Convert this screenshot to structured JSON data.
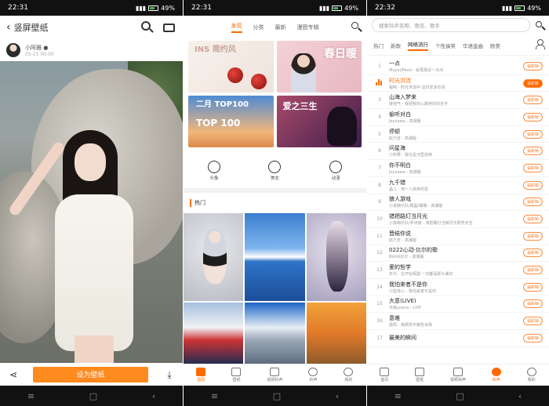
{
  "status": [
    {
      "time": "22:31",
      "battery": "49%"
    },
    {
      "time": "22:31",
      "battery": "49%"
    },
    {
      "time": "22:32",
      "battery": "49%"
    }
  ],
  "screen1": {
    "title": "竖屏壁纸",
    "user": "小阿雅 ●",
    "date": "05-15 00:00",
    "set_button": "设为壁纸",
    "share_icon": "share-icon",
    "download_icon": "download-icon"
  },
  "screen2": {
    "tabs": [
      "发现",
      "分类",
      "最新",
      "漫图专辑"
    ],
    "active_tab": 0,
    "banners": [
      {
        "text": "INS 简约风"
      },
      {
        "text": "春日暖"
      },
      {
        "text": "二月 TOP100",
        "sub": "TOP 100"
      },
      {
        "text": "爱之三生"
      }
    ],
    "categories": [
      {
        "label": "头像",
        "icon": "smile-icon"
      },
      {
        "label": "美女",
        "icon": "girl-icon"
      },
      {
        "label": "动漫",
        "icon": "anime-icon"
      }
    ],
    "hot_label": "热门",
    "bottom_tabs": [
      {
        "label": "首页",
        "icon": "home-icon",
        "active": true
      },
      {
        "label": "壁纸",
        "icon": "image-icon",
        "active": false
      },
      {
        "label": "视频铃声",
        "icon": "video-icon",
        "active": false
      },
      {
        "label": "铃声",
        "icon": "bell-icon",
        "active": false
      },
      {
        "label": "我的",
        "icon": "user-icon",
        "active": false
      }
    ]
  },
  "screen3": {
    "search_placeholder": "搜索铃声名称、歌名、歌手",
    "tabs": [
      "热门",
      "新歌",
      "网络流行",
      "个性搞笑",
      "华语金曲",
      "欧美"
    ],
    "active_tab": 2,
    "ring_label": "设彩铃",
    "songs": [
      {
        "rank": "1",
        "title": "一点",
        "sub": "Muyoi/Pezzi - 就再靠近一点点"
      },
      {
        "rank": "2",
        "title": "时光洪流",
        "sub": "程响 - 时光洪流中 这份爱多珍贵",
        "playing": true
      },
      {
        "rank": "3",
        "title": "山海入梦来",
        "sub": "接地气 - 我把我的心跳用你的名字"
      },
      {
        "rank": "4",
        "title": "偷听对白",
        "sub": "Jeyxawa - 高潮版"
      },
      {
        "rank": "5",
        "title": "停顿",
        "sub": "赵乃吉 - 高潮版"
      },
      {
        "rank": "6",
        "title": "问星海",
        "sub": "小阿果 - 我在星河里找到"
      },
      {
        "rank": "7",
        "title": "你不明白",
        "sub": "Jeyxawa - 高潮版"
      },
      {
        "rank": "8",
        "title": "九千错",
        "sub": "晶儿 - 用一人拼命的爱"
      },
      {
        "rank": "9",
        "title": "狼人游戏",
        "sub": "小孩萌乐队/聂磊/嘴嘴 - 高潮版"
      },
      {
        "rank": "10",
        "title": "错把路灯当月光",
        "sub": "小孩萌乐队/尹诗雨 - 我把路灯当做月光照亮天空"
      },
      {
        "rank": "11",
        "title": "晋结你说",
        "sub": "赵乃吉 - 高潮版"
      },
      {
        "rank": "12",
        "title": "0222心动·比尔的歌",
        "sub": "Bomb比尔 - 高潮版"
      },
      {
        "rank": "13",
        "title": "爱的哲学",
        "sub": "年代 - 在开始相遇 一切都是那么美好"
      },
      {
        "rank": "14",
        "title": "我怕来者不是你",
        "sub": "小蓝背心 - 我怕来者不是你"
      },
      {
        "rank": "15",
        "title": "大意(LIVE)",
        "sub": "许嵩yoona - LIVE"
      },
      {
        "rank": "16",
        "title": "意难",
        "sub": "晨阳 - 我那样平静告诉我"
      },
      {
        "rank": "17",
        "title": "最美的瞬间",
        "sub": ""
      }
    ],
    "bottom_tabs": [
      {
        "label": "首页",
        "icon": "home-icon",
        "active": false
      },
      {
        "label": "壁纸",
        "icon": "image-icon",
        "active": false
      },
      {
        "label": "视频铃声",
        "icon": "video-icon",
        "active": false
      },
      {
        "label": "铃声",
        "icon": "bell-icon",
        "active": true
      },
      {
        "label": "我的",
        "icon": "user-icon",
        "active": false
      }
    ]
  },
  "colors": {
    "accent": "#ff6a00",
    "button": "#ff8a1e"
  }
}
